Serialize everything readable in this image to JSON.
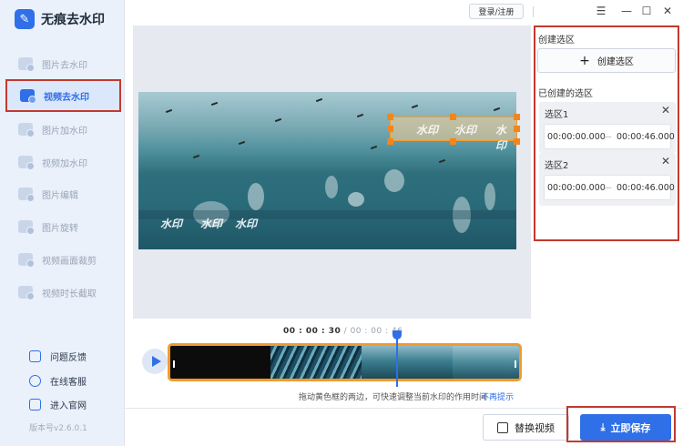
{
  "app": {
    "title": "无痕去水印",
    "logo_icon": "logo-icon"
  },
  "topbar": {
    "login_label": "登录/注册"
  },
  "sidebar": {
    "items": [
      {
        "label": "图片去水印",
        "icon": "image-icon",
        "active": false
      },
      {
        "label": "视频去水印",
        "icon": "video-icon",
        "active": true
      },
      {
        "label": "图片加水印",
        "icon": "image-icon",
        "active": false
      },
      {
        "label": "视频加水印",
        "icon": "video-icon",
        "active": false
      },
      {
        "label": "图片编辑",
        "icon": "image-icon",
        "active": false
      },
      {
        "label": "图片旋转",
        "icon": "image-icon",
        "active": false
      },
      {
        "label": "视频画面裁剪",
        "icon": "video-icon",
        "active": false
      },
      {
        "label": "视频时长截取",
        "icon": "video-icon",
        "active": false
      }
    ],
    "footer_links": [
      {
        "label": "问题反馈",
        "icon": "feedback-icon"
      },
      {
        "label": "在线客服",
        "icon": "support-icon"
      },
      {
        "label": "进入官网",
        "icon": "website-icon"
      }
    ],
    "version": "版本号v2.6.0.1"
  },
  "preview": {
    "watermark_texts": [
      "水印",
      "水印",
      "水印",
      "水印",
      "水印",
      "水印"
    ]
  },
  "timeline": {
    "current_time": "00 : 00 : 30",
    "separator": " / ",
    "total_time": "00 : 00 : 46",
    "hint": "拖动黄色框的两边，可快速调整当前水印的作用时间",
    "hint_link": "不再提示"
  },
  "right_panel": {
    "create_title": "创建选区",
    "create_button": "创建选区",
    "created_title": "已创建的选区",
    "regions": [
      {
        "name": "选区1",
        "start": "00:00:00.000",
        "end": "00:00:46.000"
      },
      {
        "name": "选区2",
        "start": "00:00:00.000",
        "end": "00:00:46.000"
      }
    ]
  },
  "actions": {
    "replace_label": "替换视频",
    "save_label": "立即保存"
  },
  "colors": {
    "accent": "#2f6fe8",
    "highlight": "#c23a2e",
    "selection": "#f29b2c"
  }
}
